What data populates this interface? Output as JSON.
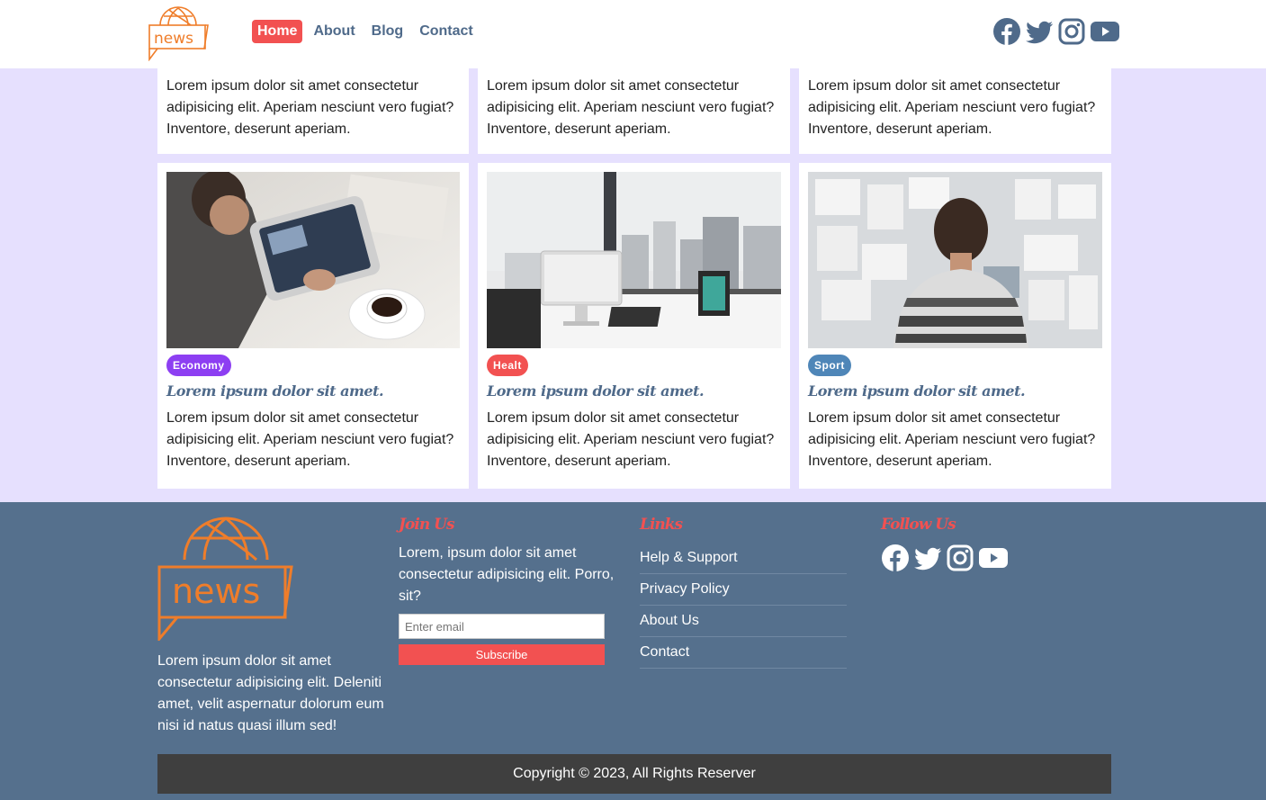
{
  "header": {
    "logo_text": "news",
    "nav": [
      {
        "label": "Home",
        "active": true
      },
      {
        "label": "About",
        "active": false
      },
      {
        "label": "Blog",
        "active": false
      },
      {
        "label": "Contact",
        "active": false
      }
    ],
    "social_icons": [
      "facebook-icon",
      "twitter-icon",
      "instagram-icon",
      "youtube-icon"
    ]
  },
  "top_cards": [
    {
      "text": "Lorem ipsum dolor sit amet consectetur adipisicing elit. Aperiam nesciunt vero fugiat? Inventore, deserunt aperiam."
    },
    {
      "text": "Lorem ipsum dolor sit amet consectetur adipisicing elit. Aperiam nesciunt vero fugiat? Inventore, deserunt aperiam."
    },
    {
      "text": "Lorem ipsum dolor sit amet consectetur adipisicing elit. Aperiam nesciunt vero fugiat? Inventore, deserunt aperiam."
    }
  ],
  "cards": [
    {
      "image": "man-with-tablet-photo",
      "badge": "Economy",
      "badge_color": "#8d3ff2",
      "title": "Lorem ipsum dolor sit amet.",
      "text": "Lorem ipsum dolor sit amet consectetur adipisicing elit. Aperiam nesciunt vero fugiat? Inventore, deserunt aperiam."
    },
    {
      "image": "office-desk-photo",
      "badge": "Healt",
      "badge_color": "#f25151",
      "title": "Lorem ipsum dolor sit amet.",
      "text": "Lorem ipsum dolor sit amet consectetur adipisicing elit. Aperiam nesciunt vero fugiat? Inventore, deserunt aperiam."
    },
    {
      "image": "man-at-board-photo",
      "badge": "Sport",
      "badge_color": "#4f86b8",
      "title": "Lorem ipsum dolor sit amet.",
      "text": "Lorem ipsum dolor sit amet consectetur adipisicing elit. Aperiam nesciunt vero fugiat? Inventore, deserunt aperiam."
    }
  ],
  "footer": {
    "logo_text": "news",
    "about_text": "Lorem ipsum dolor sit amet consectetur adipisicing elit. Deleniti amet, velit aspernatur dolorum eum nisi id natus quasi illum sed!",
    "join": {
      "heading": "Join Us",
      "text": "Lorem, ipsum dolor sit amet consectetur adipisicing elit. Porro, sit?",
      "email_placeholder": "Enter email",
      "button": "Subscribe"
    },
    "links": {
      "heading": "Links",
      "items": [
        "Help & Support",
        "Privacy Policy",
        "About Us",
        "Contact"
      ]
    },
    "follow": {
      "heading": "Follow Us",
      "icons": [
        "facebook-icon",
        "twitter-icon",
        "instagram-icon",
        "youtube-icon"
      ]
    },
    "copyright": "Copyright © 2023, All Rights Reserver"
  },
  "colors": {
    "accent": "#f25151",
    "nav_text": "#4f6a8a",
    "page_bg": "#e6e0fe",
    "footer_bg": "#55708d",
    "logo_orange": "#ef7d2a"
  }
}
